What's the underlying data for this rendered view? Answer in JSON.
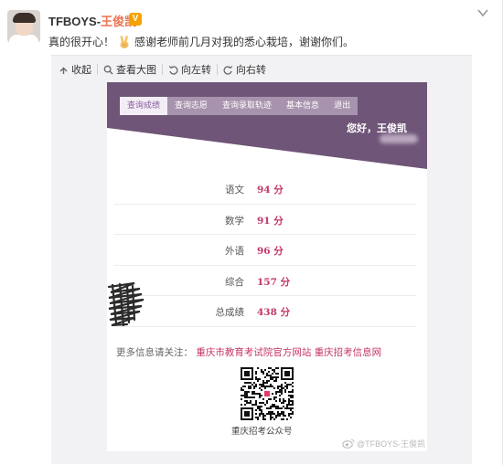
{
  "post": {
    "username_latin": "TFBOYS-",
    "username_cn": "王俊凯",
    "verified_badge": "V",
    "text_before": "真的很开心！",
    "text_after": "感谢老师前几月对我的悉心栽培，谢谢你们。",
    "emoji_icon": "victory-hand-icon",
    "more_icon": "chevron-down-icon"
  },
  "toolbar": {
    "collapse_label": "收起",
    "view_large_label": "查看大图",
    "rotate_left_label": "向左转",
    "rotate_right_label": "向右转"
  },
  "screenshot": {
    "tabs": [
      {
        "label": "查询成绩",
        "active": true
      },
      {
        "label": "查询志愿",
        "active": false
      },
      {
        "label": "查询录取轨迹",
        "active": false
      },
      {
        "label": "基本信息",
        "active": false
      },
      {
        "label": "退出",
        "active": false
      }
    ],
    "greeting": "您好，王俊凯",
    "scores": [
      {
        "subject": "语文",
        "score": "94 分"
      },
      {
        "subject": "数学",
        "score": "91 分"
      },
      {
        "subject": "外语",
        "score": "96 分"
      },
      {
        "subject": "综合",
        "score": "157 分"
      },
      {
        "subject": "总成绩",
        "score": "438 分"
      }
    ],
    "info_prefix": "更多信息请关注：",
    "link_1": "重庆市教育考试院官方网站",
    "link_2": "重庆招考信息网",
    "qr_caption": "重庆招考公众号"
  },
  "watermark": "@TFBOYS-王俊凯",
  "colors": {
    "banner_purple": "#6f5577",
    "score_pink": "#c4356a",
    "username_orange": "#eb7350",
    "badge_gold": "#f7a100"
  }
}
